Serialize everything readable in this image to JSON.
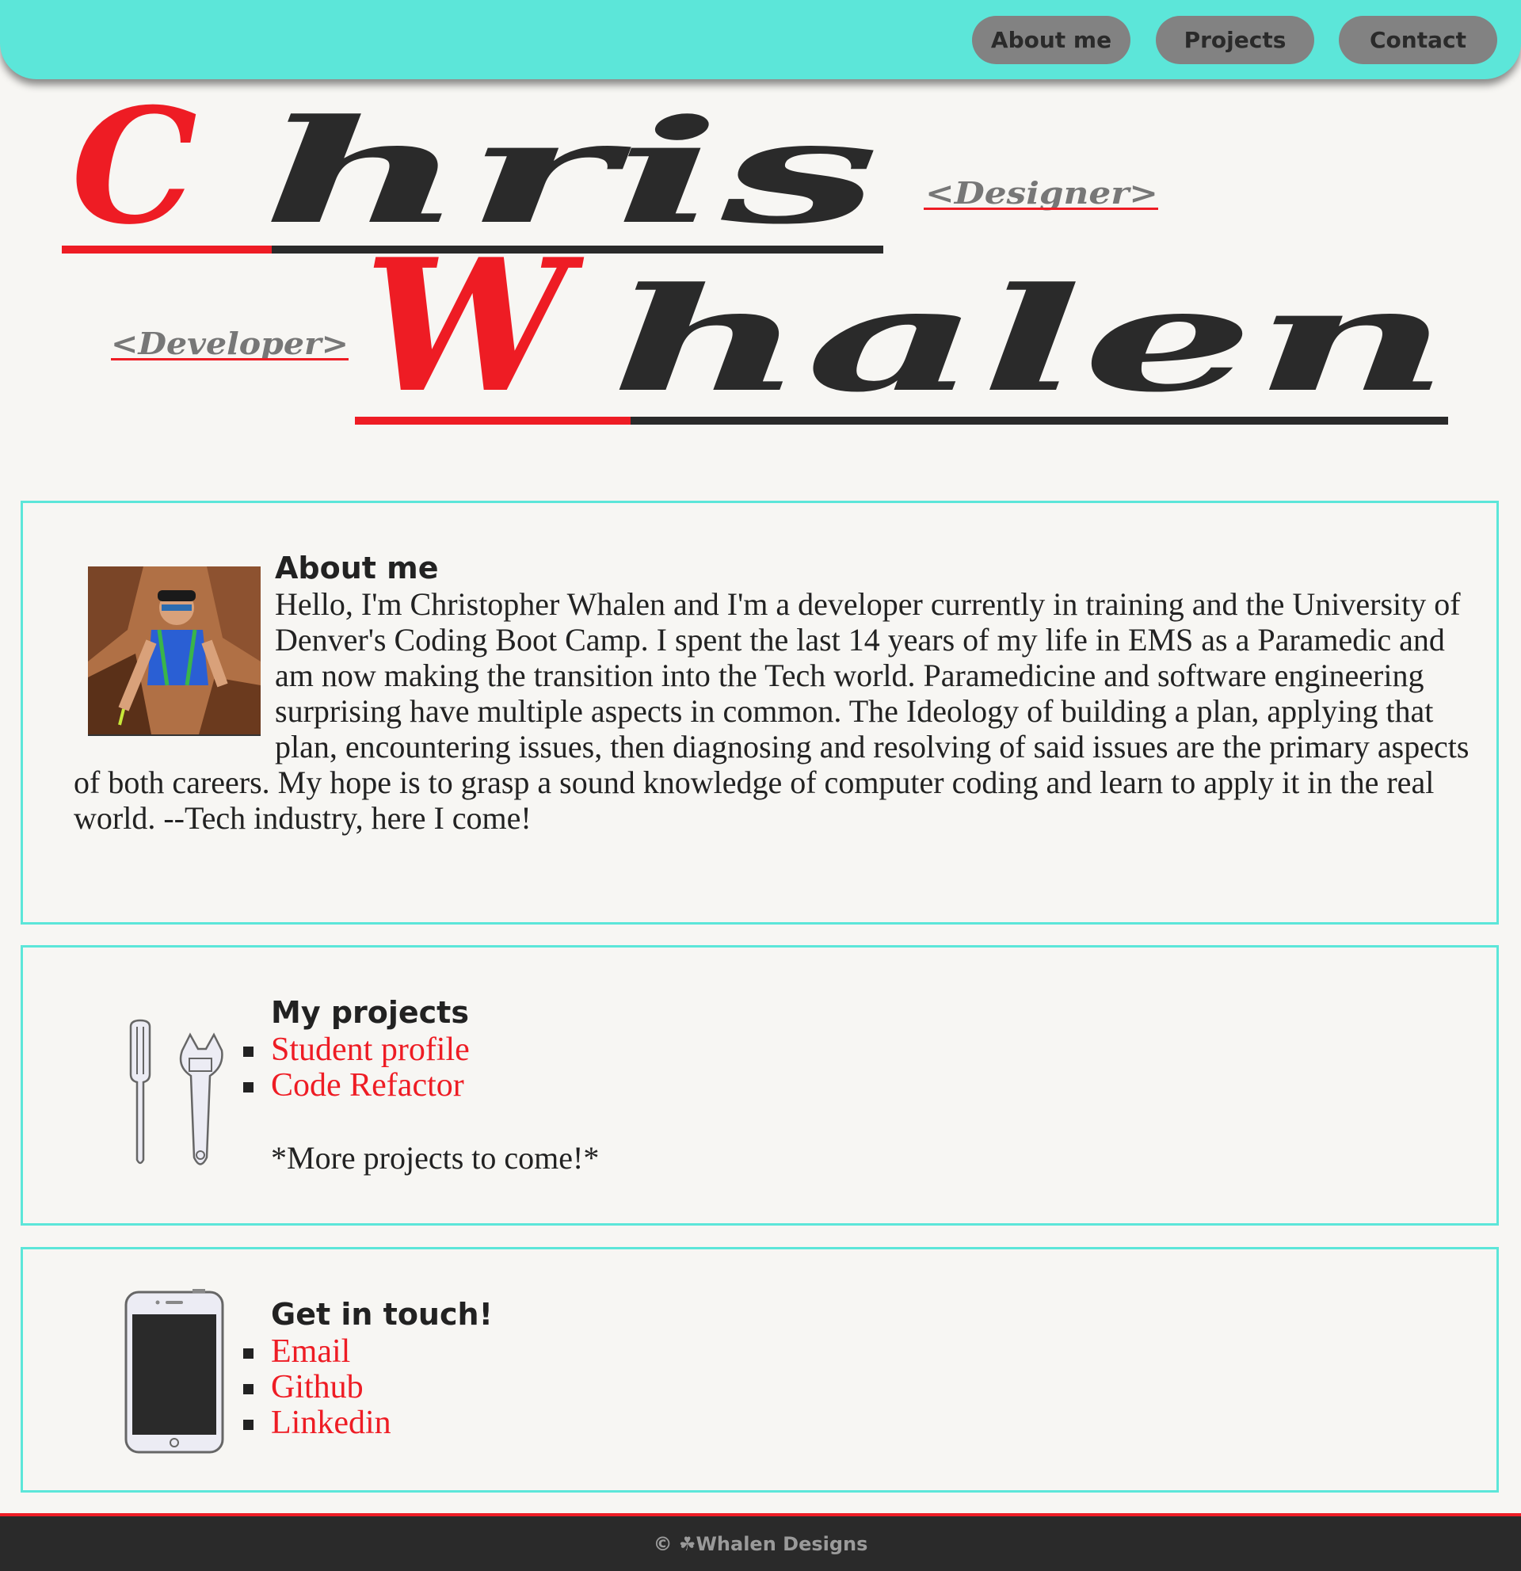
{
  "nav": {
    "about_label": "About me",
    "projects_label": "Projects",
    "contact_label": "Contact"
  },
  "logo": {
    "first_initial": "C",
    "first_rest": "hris",
    "last_initial": "W",
    "last_rest": "halen",
    "tag_designer": "<Designer>",
    "tag_developer": "<Developer>"
  },
  "about": {
    "title": "About me",
    "text": "Hello, I'm Christopher Whalen and I'm a developer currently in training and the University of Denver's Coding Boot Camp. I spent the last 14 years of my life in EMS as a Paramedic and am now making the transition into the Tech world. Paramedicine and software engineering surprising have multiple aspects in common. The Ideology of building a plan, applying that plan, encountering issues, then diagnosing and resolving of said issues are the primary aspects of both careers. My hope is to grasp a sound knowledge of computer coding and learn to apply it in the real world. --Tech industry, here I come!"
  },
  "projects": {
    "title": "My projects",
    "links": [
      "Student profile",
      "Code Refactor"
    ],
    "note": "*More projects to come!*"
  },
  "contact": {
    "title": "Get in touch!",
    "links": [
      "Email",
      "Github",
      "Linkedin"
    ]
  },
  "footer": {
    "text": "© ☘Whalen Designs"
  },
  "colors": {
    "accent": "#5ce6d9",
    "red": "#ee1c24",
    "dark": "#2a2a2a",
    "button": "#828282"
  }
}
